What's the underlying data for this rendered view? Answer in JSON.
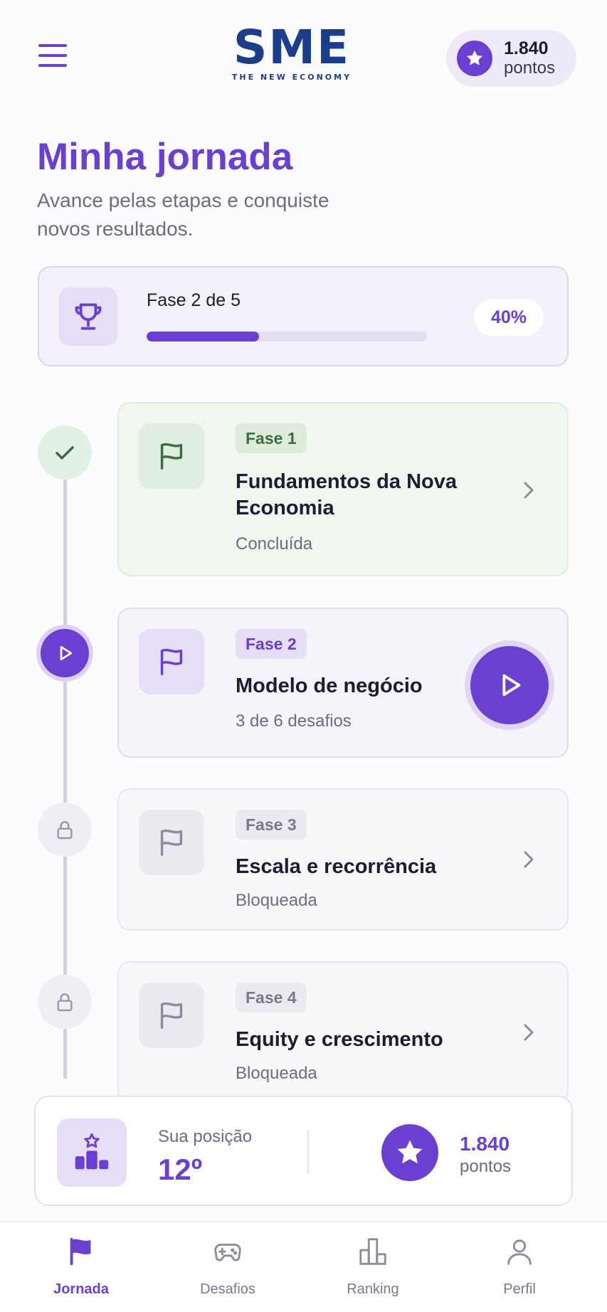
{
  "header": {
    "logo_main": "SME",
    "logo_sub": "THE NEW ECONOMY",
    "points_value": "1.840",
    "points_label": "pontos"
  },
  "page": {
    "title": "Minha jornada",
    "subtitle": "Avance pelas etapas e conquiste novos resultados."
  },
  "progress": {
    "phase_label": "Fase 2 de 5",
    "percent_label": "40%",
    "percent_value": 40
  },
  "phases": [
    {
      "badge": "Fase 1",
      "title": "Fundamentos da Nova Economia",
      "status": "Concluída",
      "state": "done"
    },
    {
      "badge": "Fase 2",
      "title": "Modelo de negócio",
      "status": "3 de 6 desafios",
      "state": "active"
    },
    {
      "badge": "Fase 3",
      "title": "Escala e recorrência",
      "status": "Bloqueada",
      "state": "locked"
    },
    {
      "badge": "Fase 4",
      "title": "Equity e crescimento",
      "status": "Bloqueada",
      "state": "locked"
    }
  ],
  "summary": {
    "position_label": "Sua posição",
    "position_value": "12º",
    "points_value": "1.840",
    "points_label": "pontos"
  },
  "nav": [
    {
      "label": "Jornada",
      "icon": "flag-icon",
      "active": true
    },
    {
      "label": "Desafios",
      "icon": "gamepad-icon",
      "active": false
    },
    {
      "label": "Ranking",
      "icon": "podium-icon",
      "active": false
    },
    {
      "label": "Perfil",
      "icon": "person-icon",
      "active": false
    }
  ],
  "colors": {
    "accent": "#6a3fd1",
    "brand": "#1b3e8c",
    "done": "#3f6b46"
  }
}
